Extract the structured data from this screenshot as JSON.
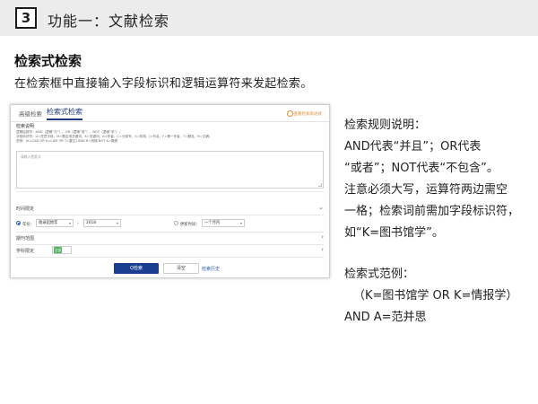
{
  "header": {
    "number": "3",
    "title": "功能一：文献检索"
  },
  "section": {
    "title": "检索式检索",
    "description": "在检索框中直接输入字段标识和逻辑运算符来发起检索。"
  },
  "panel": {
    "tabs": [
      "高级检索",
      "检索式检索"
    ],
    "active_tab": 1,
    "help_link": "查看检索表达式",
    "instructions_title": "检索说明",
    "instructions_lines": [
      "逻辑运算符：AND（逻辑“与”）、OR（逻辑“或”）、NOT（逻辑“非”）；",
      "字段标识符：U=任意字段，M=题名或关键词，K=关键词，A=作者，C=分类号，S=机构，J=刊名，F=第一作者，T=题名，R=文摘；",
      "范例：(K=CAD OR K=CAM OR T=雷达) AND R=机械 NOT K=模具"
    ],
    "textarea_placeholder": "请输入检索式",
    "time_section": "时间限定",
    "year_label": "年份：",
    "year_from": "收录起始年",
    "dash": "-",
    "year_to": "2018",
    "update_label": "更新时间：",
    "update_value": "一个月内",
    "journal_section": "期刊范围",
    "subject_section": "学科限定",
    "subject_tag": "全部",
    "search_button": "Q检索",
    "reset_button": "清空",
    "history_link": "检索历史"
  },
  "rules": {
    "title": "检索规则说明：",
    "lines": [
      "AND代表“并且”；OR代表",
      "“或者”；NOT代表“不包含”。",
      "注意必须大写，运算符两边需空",
      "一格；检索词前需加字段标识符，",
      "如“K=图书馆学”。"
    ]
  },
  "example": {
    "title": "检索式范例：",
    "lines": [
      "（K=图书馆学 OR K=情报学）",
      "AND A=范并思"
    ]
  }
}
